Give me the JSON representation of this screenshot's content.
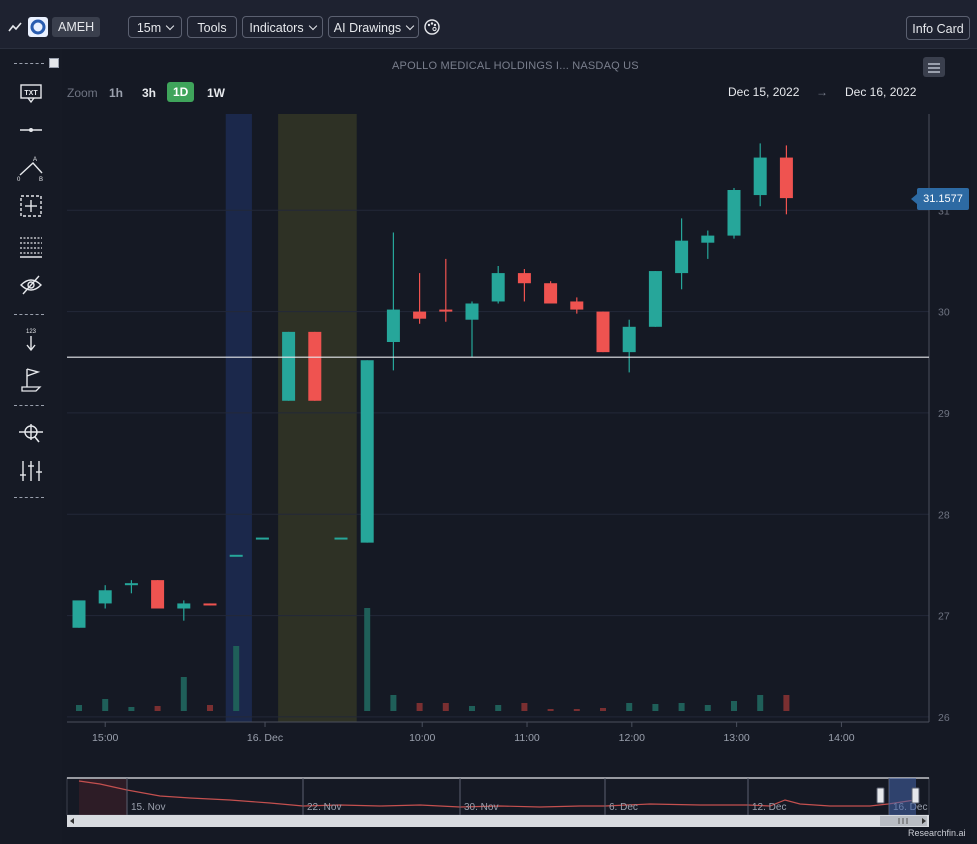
{
  "toolbar": {
    "ticker": "AMEH",
    "interval": "15m",
    "tools": "Tools",
    "indicators": "Indicators",
    "ai_drawings": "AI Drawings",
    "info_card": "Info Card"
  },
  "header": {
    "title": "APOLLO MEDICAL HOLDINGS I... NASDAQ US",
    "zoom_label": "Zoom",
    "zoom_options": [
      "1h",
      "3h",
      "1D",
      "1W"
    ],
    "zoom_active": "1D",
    "date_from": "Dec 15, 2022",
    "date_arrow": "→",
    "date_to": "Dec 16, 2022"
  },
  "sidebar_icons": [
    "text-tool-icon",
    "horizontal-line-icon",
    "abc-pattern-icon",
    "crosshair-box-icon",
    "fib-levels-icon",
    "hide-eye-icon",
    "price-label-icon",
    "flag-icon",
    "zoom-crosshair-icon",
    "adjust-bars-icon"
  ],
  "colors": {
    "up": "#26a69a",
    "down": "#ef5350",
    "accent": "#3fa45b",
    "price_tag": "#2d6aa3"
  },
  "chart_data": {
    "type": "candlestick",
    "x_tick_labels": [
      "15:00",
      "16. Dec",
      "10:00",
      "11:00",
      "12:00",
      "13:00",
      "14:00"
    ],
    "y_tick_labels": [
      "26",
      "27",
      "28",
      "29",
      "30",
      "31"
    ],
    "ylim": [
      25.95,
      31.95
    ],
    "last_price": "31.1577",
    "horizontal_line": 29.55,
    "candles": [
      {
        "o": 26.88,
        "h": 27.12,
        "l": 26.88,
        "c": 27.15
      },
      {
        "o": 27.12,
        "h": 27.3,
        "l": 27.07,
        "c": 27.25
      },
      {
        "o": 27.3,
        "h": 27.35,
        "l": 27.22,
        "c": 27.32
      },
      {
        "o": 27.35,
        "h": 27.35,
        "l": 27.07,
        "c": 27.07
      },
      {
        "o": 27.07,
        "h": 27.15,
        "l": 26.95,
        "c": 27.12
      },
      {
        "o": 27.12,
        "h": 27.12,
        "l": 27.1,
        "c": 27.1
      },
      {
        "o": 27.6,
        "h": 27.6,
        "l": 27.6,
        "c": 27.6
      },
      {
        "o": 27.77,
        "h": 27.77,
        "l": 27.77,
        "c": 27.77
      },
      {
        "o": 29.12,
        "h": 29.8,
        "l": 29.12,
        "c": 29.8
      },
      {
        "o": 29.8,
        "h": 29.8,
        "l": 29.12,
        "c": 29.12
      },
      {
        "o": 27.77,
        "h": 27.77,
        "l": 27.77,
        "c": 27.77
      },
      {
        "o": 27.72,
        "h": 29.52,
        "l": 27.72,
        "c": 29.52
      },
      {
        "o": 29.7,
        "h": 30.78,
        "l": 29.42,
        "c": 30.02
      },
      {
        "o": 30.0,
        "h": 30.38,
        "l": 29.88,
        "c": 29.93
      },
      {
        "o": 30.02,
        "h": 30.52,
        "l": 29.9,
        "c": 30.0
      },
      {
        "o": 29.92,
        "h": 30.1,
        "l": 29.55,
        "c": 30.08
      },
      {
        "o": 30.1,
        "h": 30.45,
        "l": 30.08,
        "c": 30.38
      },
      {
        "o": 30.38,
        "h": 30.42,
        "l": 30.1,
        "c": 30.28
      },
      {
        "o": 30.28,
        "h": 30.3,
        "l": 30.08,
        "c": 30.08
      },
      {
        "o": 30.1,
        "h": 30.14,
        "l": 29.98,
        "c": 30.02
      },
      {
        "o": 30.0,
        "h": 30.0,
        "l": 29.6,
        "c": 29.6
      },
      {
        "o": 29.6,
        "h": 29.92,
        "l": 29.4,
        "c": 29.85
      },
      {
        "o": 29.85,
        "h": 30.4,
        "l": 29.85,
        "c": 30.4
      },
      {
        "o": 30.38,
        "h": 30.92,
        "l": 30.22,
        "c": 30.7
      },
      {
        "o": 30.68,
        "h": 30.8,
        "l": 30.52,
        "c": 30.75
      },
      {
        "o": 30.75,
        "h": 31.22,
        "l": 30.72,
        "c": 31.2
      },
      {
        "o": 31.15,
        "h": 31.66,
        "l": 31.04,
        "c": 31.52
      },
      {
        "o": 31.52,
        "h": 31.64,
        "l": 30.96,
        "c": 31.12
      }
    ],
    "volumes": [
      6,
      12,
      4,
      5,
      34,
      6,
      65,
      0,
      0,
      0,
      0,
      103,
      16,
      8,
      8,
      5,
      6,
      8,
      2,
      2,
      3,
      8,
      7,
      8,
      6,
      10,
      16,
      16
    ],
    "highlight_bands": [
      {
        "from_index": 5.6,
        "to_index": 6.6,
        "color": "blue"
      },
      {
        "from_index": 7.6,
        "to_index": 10.6,
        "color": "olive"
      }
    ],
    "navigator_labels": [
      "15. Nov",
      "22. Nov",
      "30. Nov",
      "6. Dec",
      "12. Dec",
      "16. Dec"
    ]
  },
  "footer": {
    "brand": "Researchfin.ai"
  }
}
